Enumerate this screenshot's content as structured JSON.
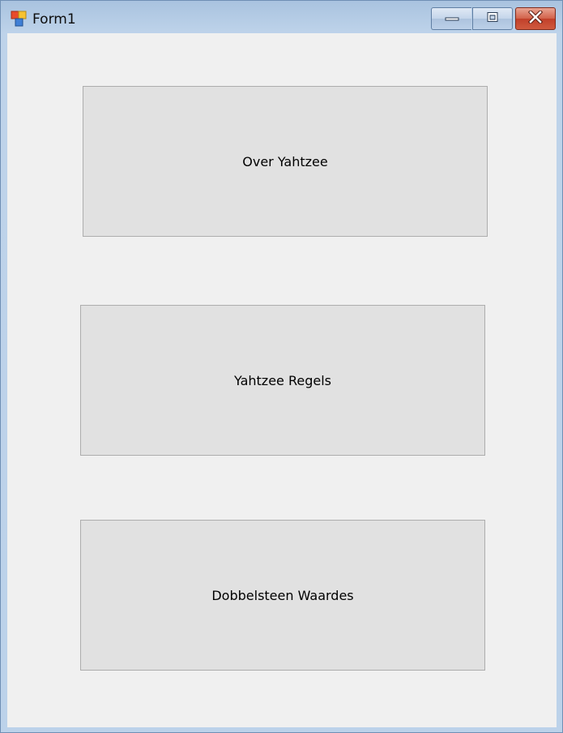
{
  "window": {
    "title": "Form1",
    "icon": "winforms-app-icon",
    "controls": {
      "minimize": "minimize-icon",
      "maximize": "maximize-icon",
      "close": "close-icon"
    }
  },
  "main": {
    "buttons": [
      {
        "label": "Over Yahtzee"
      },
      {
        "label": "Yahtzee Regels"
      },
      {
        "label": "Dobbelsteen Waardes"
      }
    ]
  },
  "colors": {
    "form_background": "#f0f0f0",
    "button_background": "#e1e1e1",
    "button_border": "#adadad",
    "close_button": "#c1402a"
  }
}
